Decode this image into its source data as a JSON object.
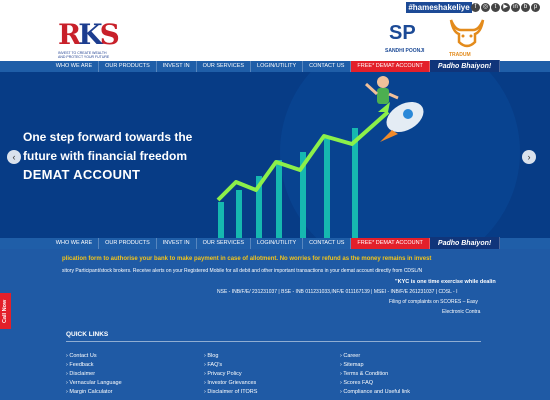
{
  "topbar": {
    "hashtag": "#hameshakeliye",
    "social": [
      {
        "icon": "facebook-icon",
        "glyph": "f"
      },
      {
        "icon": "instagram-icon",
        "glyph": "◎"
      },
      {
        "icon": "twitter-icon",
        "glyph": "t"
      },
      {
        "icon": "youtube-icon",
        "glyph": "▶"
      },
      {
        "icon": "linkedin-icon",
        "glyph": "in"
      },
      {
        "icon": "blog-icon",
        "glyph": "b"
      },
      {
        "icon": "pinterest-icon",
        "glyph": "p"
      }
    ]
  },
  "header": {
    "logo_text": "RKS",
    "logo_tagline": "INVEST TO CREATE WEALTH AND PROTECT YOUR FUTURE",
    "sp_logo": "SP",
    "sp_sub": "SANDHI     POONJI",
    "tradum_sub": "TRADUM"
  },
  "nav": {
    "items": [
      "WHO WE ARE",
      "OUR PRODUCTS",
      "INVEST IN",
      "OUR SERVICES",
      "LOGIN/UTILITY",
      "CONTACT US",
      "FREE* DEMAT ACCOUNT"
    ],
    "padho": "Padho Bhaiyon!"
  },
  "banner": {
    "line1": "One step forward towards the",
    "line2": "future with financial freedom",
    "line3": "DEMAT ACCOUNT",
    "prev": "‹",
    "next": "›"
  },
  "footer": {
    "ticker": "plication form to authorise your bank to make payment in case of allotment. No worries for refund as the money remains in invest",
    "ticker2": "sitory Participant/stock brokers. Receive alerts on your Registered Mobile for all debit and other important transactions in your demat account directly from CDSL/N",
    "kyc": "\"KYC is one time exercise while dealin",
    "info1": "NSE - INB/F/E/ 231231037 | BSE - INB 011231033,INF/E 011167139 | MSEI - INB/F/E 261231037 | CDSL - I",
    "info2": "Filing of complaints on SCORES – Easy",
    "info3": "Electronic Contra",
    "quick_links": "QUICK LINKS",
    "col1": [
      "Contact Us",
      "Feedback",
      "Disclaimer",
      "Vernacular Language",
      "Margin Calculator"
    ],
    "col2": [
      "Blog",
      "FAQ's",
      "Privacy Policy",
      "Investor Grievances",
      "Disclaimer of ITORS"
    ],
    "col3": [
      "Career",
      "Sitemap",
      "Terms & Condition",
      "Scores FAQ",
      "Compliance and Useful link"
    ],
    "call_now": "Call Now"
  },
  "colors": {
    "nav": "#1f5ea8",
    "banner": "#073c86",
    "footer": "#1f5aa5",
    "accent_red": "#e3202a",
    "ticker_yellow": "#f5c518"
  }
}
